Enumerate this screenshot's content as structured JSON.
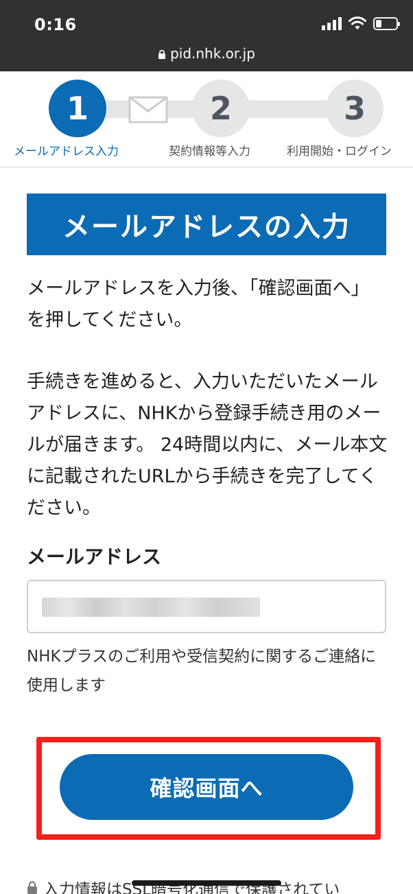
{
  "status_bar": {
    "time": "0:16",
    "url": "pid.nhk.or.jp"
  },
  "stepper": {
    "steps": [
      {
        "number": "1",
        "label": "メールアドレス入力"
      },
      {
        "number": "2",
        "label": "契約情報等入力"
      },
      {
        "number": "3",
        "label": "利用開始・ログイン"
      }
    ]
  },
  "main": {
    "heading": "メールアドレスの入力",
    "paragraph_1": "メールアドレスを入力後、「確認画面へ」を押してください。",
    "paragraph_2": "手続きを進めると、入力いただいたメールアドレスに、NHKから登録手続き用のメールが届きます。 24時間以内に、メール本文に記載されたURLから手続きを完了してください。",
    "email_label": "メールアドレス",
    "email_helper": "NHKプラスのご利用や受信契約に関するご連絡に使用します",
    "confirm_button": "確認画面へ",
    "footnote": "入力情報はSSL暗号化通信で保護されてい"
  },
  "colors": {
    "brand_blue": "#0c6bb5",
    "highlight_red": "#f2211b",
    "status_bar_bg": "#2f3133"
  }
}
